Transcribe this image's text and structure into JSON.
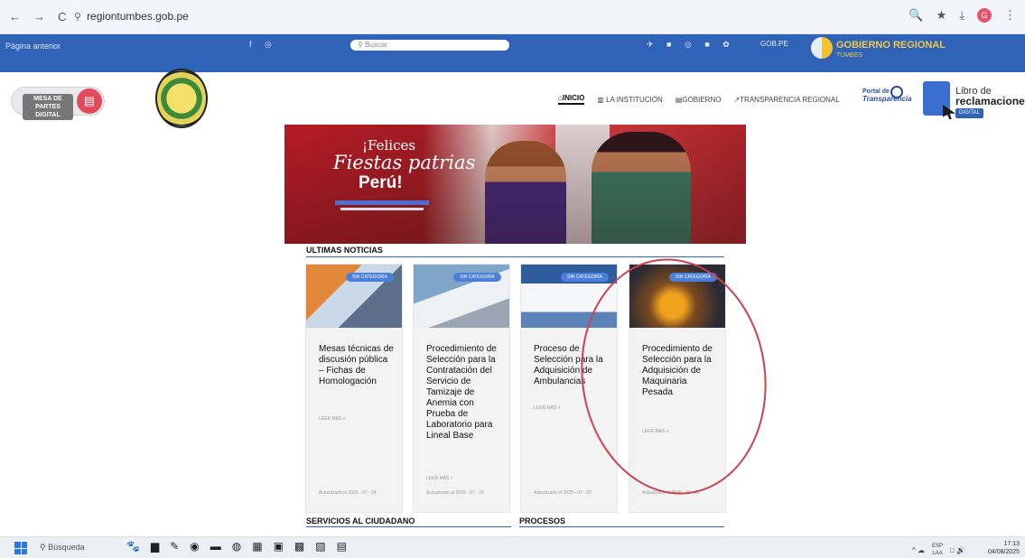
{
  "browser": {
    "nav_icons": [
      "←",
      "→",
      "C"
    ],
    "url": "regiontumbes.gob.pe",
    "right_icons": [
      "🔍",
      "★",
      "⤓"
    ],
    "avatar": "G",
    "menu": "⋮"
  },
  "topbar": {
    "prev_page": "Página anterior",
    "social_left": "f ◎",
    "search_placeholder": "Buscar",
    "social_icons": "✈ ■ ◎ ■ ✿",
    "gob_label": "GOB.PE",
    "gore_title": "GOBIERNO REGIONAL",
    "gore_sub": "TUMBES"
  },
  "header": {
    "mesa_label": "MESA DE PARTES DIGITAL",
    "nav": [
      {
        "label": "INICIO",
        "icon": "⌂"
      },
      {
        "label": "LA INSTITUCIÓN",
        "icon": "▥"
      },
      {
        "label": "GOBIERNO",
        "icon": "▤"
      },
      {
        "label": "TRANSPARENCIA REGIONAL",
        "icon": "↗"
      }
    ],
    "portal_label_1": "Portal de",
    "portal_label_2": "Transparencia",
    "libro_line1": "Libro de",
    "libro_line2": "reclamaciones",
    "libro_badge": "DIGITAL"
  },
  "banner": {
    "line1": "¡Felices",
    "line2": "Fiestas patrias",
    "line3": "Perú!"
  },
  "news": {
    "section_title": "ULTIMAS NOTICIAS",
    "cards": [
      {
        "badge": "SIN CATEGORÍA",
        "title": "Mesas técnicas de discusión pública – Fichas de Homologación",
        "more": "LEER MÁS »",
        "date": "Actualizado el 2025 - 07 - 24"
      },
      {
        "badge": "SIN CATEGORÍA",
        "title": "Procedimiento de Selección para la Contratación del Servicio de Tamizaje de Anemia con Prueba de Laboratorio para Lineal Base",
        "more": "LEER MÁS »",
        "date": "Actualizado el 2025 - 07 - 23"
      },
      {
        "badge": "SIN CATEGORÍA",
        "title": "Proceso de Selección para la Adquisición de Ambulancias",
        "more": "LEER MÁS »",
        "date": "Actualizado el 2025 - 07 - 22"
      },
      {
        "badge": "SIN CATEGORÍA",
        "title": "Procedimiento de Selección para la Adquisición de Maquinaria Pesada",
        "more": "LEER MÁS »",
        "date": "Actualizado el 2025 - 07 - 21"
      }
    ]
  },
  "lower": {
    "servicios": "SERVICIOS AL CIUDADANO",
    "procesos": "PROCESOS"
  },
  "taskbar": {
    "search": "Búsqueda",
    "apps": [
      "🐾",
      "▆",
      "✎",
      "◉",
      "▬",
      "◍",
      "▦",
      "▣",
      "▩",
      "▧",
      "▤"
    ],
    "tray_icons": "^ ☁",
    "lang1": "ESP",
    "lang2": "LAA",
    "sound": "□ 🔊",
    "time": "17:13",
    "date": "04/08/2025"
  }
}
